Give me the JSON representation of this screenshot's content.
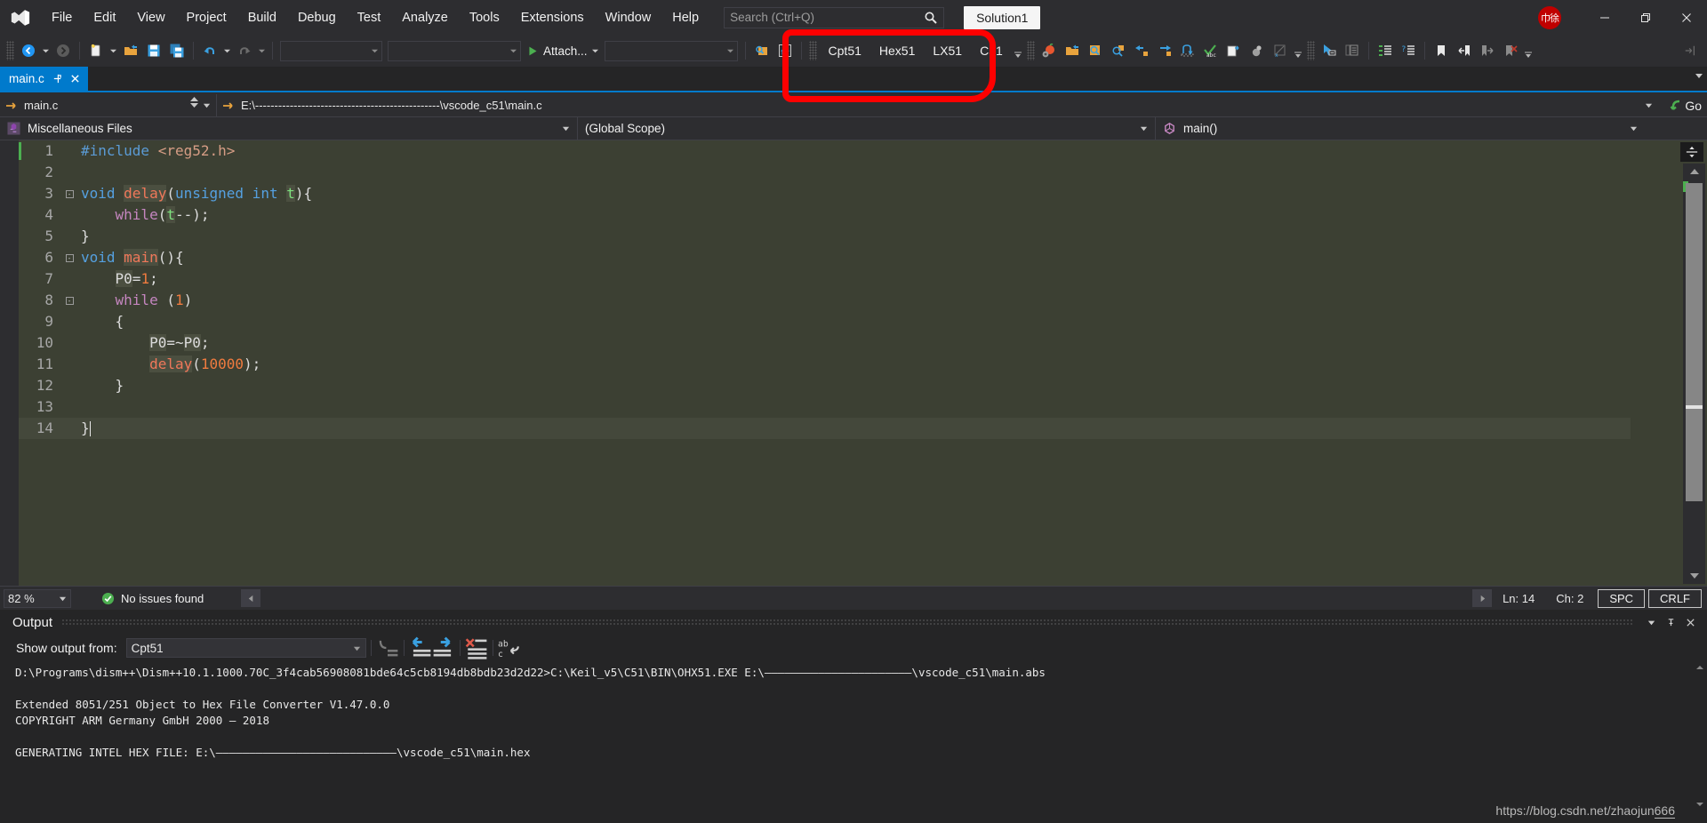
{
  "app": {
    "logo_icon": "visual-studio-logo",
    "solution_chip": "Solution1",
    "avatar_initials": "巾徐"
  },
  "menu": {
    "items": [
      {
        "label": "File"
      },
      {
        "label": "Edit"
      },
      {
        "label": "View"
      },
      {
        "label": "Project"
      },
      {
        "label": "Build"
      },
      {
        "label": "Debug"
      },
      {
        "label": "Test"
      },
      {
        "label": "Analyze"
      },
      {
        "label": "Tools"
      },
      {
        "label": "Extensions"
      },
      {
        "label": "Window"
      },
      {
        "label": "Help"
      }
    ]
  },
  "search": {
    "placeholder": "Search (Ctrl+Q)",
    "value": "",
    "icon": "search-icon"
  },
  "window_controls": {
    "minimize": "minimize-icon",
    "restore": "restore-icon",
    "close": "close-icon"
  },
  "toolbar": {
    "navigate_back_icon": "navigate-back-icon",
    "navigate_forward_icon": "navigate-forward-icon",
    "new_project_icon": "new-project-icon",
    "open_file_icon": "open-file-icon",
    "save_icon": "save-icon",
    "save_all_icon": "save-all-icon",
    "undo_icon": "undo-icon",
    "redo_icon": "redo-icon",
    "combo1_value": "",
    "combo2_value": "",
    "attach_label": "Attach...",
    "combo3_value": "",
    "find_in_files_icon": "find-in-files-icon",
    "home_icon": "home-icon",
    "keil_commands": [
      "Cpt51",
      "Hex51",
      "LX51",
      "C51"
    ],
    "overflow_icon": "toolbar-overflow-icon"
  },
  "annotation": {
    "type": "red-highlight-rectangle",
    "color": "#fe0000",
    "targets": "Cpt51 Hex51 LX51 C51"
  },
  "tabs": [
    {
      "label": "main.c",
      "active": true,
      "pin_icon": "pin-icon",
      "close_icon": "close-icon"
    }
  ],
  "navbar": {
    "file_selector": "main.c",
    "file_path": "E:\\------------------------------------------------\\vscode_c51\\main.c",
    "project": "Miscellaneous Files",
    "scope": "(Global Scope)",
    "member": "main()",
    "go_label": "Go"
  },
  "editor": {
    "background": "#3c4033",
    "cursor_line": 14,
    "lines": [
      {
        "n": 1,
        "fold": "",
        "tokens": [
          {
            "t": "#include ",
            "c": "k-pp"
          },
          {
            "t": "<reg52.h>",
            "c": "k-inc"
          }
        ],
        "mark": true
      },
      {
        "n": 2,
        "fold": "",
        "tokens": []
      },
      {
        "n": 3,
        "fold": "-",
        "tokens": [
          {
            "t": "void ",
            "c": "k-type"
          },
          {
            "t": "delay",
            "c": "k-fn hl"
          },
          {
            "t": "(",
            "c": "k-pl"
          },
          {
            "t": "unsigned int ",
            "c": "k-type"
          },
          {
            "t": "t",
            "c": "k-var hl"
          },
          {
            "t": "){",
            "c": "k-pl"
          }
        ]
      },
      {
        "n": 4,
        "fold": "",
        "tokens": [
          {
            "t": "    ",
            "c": "k-pl"
          },
          {
            "t": "while",
            "c": "k-kw"
          },
          {
            "t": "(",
            "c": "k-pl"
          },
          {
            "t": "t",
            "c": "k-var hl"
          },
          {
            "t": "--);",
            "c": "k-pl"
          }
        ]
      },
      {
        "n": 5,
        "fold": "",
        "tokens": [
          {
            "t": "}",
            "c": "k-pl"
          }
        ]
      },
      {
        "n": 6,
        "fold": "-",
        "tokens": [
          {
            "t": "void ",
            "c": "k-type"
          },
          {
            "t": "main",
            "c": "k-fn hl"
          },
          {
            "t": "(){",
            "c": "k-pl"
          }
        ]
      },
      {
        "n": 7,
        "fold": "",
        "tokens": [
          {
            "t": "    ",
            "c": "k-pl"
          },
          {
            "t": "P0",
            "c": "k-pl hl"
          },
          {
            "t": "=",
            "c": "k-pl"
          },
          {
            "t": "1",
            "c": "k-num"
          },
          {
            "t": ";",
            "c": "k-pl"
          }
        ]
      },
      {
        "n": 8,
        "fold": "-",
        "tokens": [
          {
            "t": "    ",
            "c": "k-pl"
          },
          {
            "t": "while",
            "c": "k-kw"
          },
          {
            "t": " (",
            "c": "k-pl"
          },
          {
            "t": "1",
            "c": "k-num"
          },
          {
            "t": ")",
            "c": "k-pl"
          }
        ]
      },
      {
        "n": 9,
        "fold": "",
        "tokens": [
          {
            "t": "    {",
            "c": "k-pl"
          }
        ]
      },
      {
        "n": 10,
        "fold": "",
        "tokens": [
          {
            "t": "        ",
            "c": "k-pl"
          },
          {
            "t": "P0",
            "c": "k-pl hl"
          },
          {
            "t": "=~",
            "c": "k-pl"
          },
          {
            "t": "P0",
            "c": "k-pl hl"
          },
          {
            "t": ";",
            "c": "k-pl"
          }
        ]
      },
      {
        "n": 11,
        "fold": "",
        "tokens": [
          {
            "t": "        ",
            "c": "k-pl"
          },
          {
            "t": "delay",
            "c": "k-fn hl"
          },
          {
            "t": "(",
            "c": "k-pl"
          },
          {
            "t": "10000",
            "c": "k-num"
          },
          {
            "t": ");",
            "c": "k-pl"
          }
        ]
      },
      {
        "n": 12,
        "fold": "",
        "tokens": [
          {
            "t": "    }",
            "c": "k-pl"
          }
        ]
      },
      {
        "n": 13,
        "fold": "",
        "tokens": []
      },
      {
        "n": 14,
        "fold": "",
        "tokens": [
          {
            "t": "}",
            "c": "k-pl"
          }
        ],
        "cursor": true
      }
    ]
  },
  "editor_status": {
    "zoom": "82 %",
    "issues_icon": "check-circle-icon",
    "issues_text": "No issues found",
    "prev_icon": "nav-prev-icon",
    "next_icon": "nav-next-icon",
    "line": "Ln: 14",
    "col": "Ch: 2",
    "spaces": "SPC",
    "eol": "CRLF"
  },
  "output": {
    "title": "Output",
    "show_from_label": "Show output from:",
    "show_from_value": "Cpt51",
    "toolbar_icons": [
      "go-to-message-icon",
      "find-previous-icon",
      "find-next-icon",
      "clear-all-icon",
      "toggle-word-wrap-icon"
    ],
    "dropdown_icon": "chevron-down-icon",
    "pin_icon": "pin-icon",
    "close_icon": "close-icon",
    "lines": [
      "D:\\Programs\\dism++\\Dism++10.1.1000.70C_3f4cab56908081bde64c5cb8194db8bdb23d2d22>C:\\Keil_v5\\C51\\BIN\\OHX51.EXE E:\\——————————————————————\\vscode_c51\\main.abs",
      "",
      "Extended 8051/251 Object to Hex File Converter V1.47.0.0",
      "COPYRIGHT ARM Germany GmbH 2000 — 2018",
      "",
      "GENERATING INTEL HEX FILE: E:\\———————————————————————————\\vscode_c51\\main.hex"
    ]
  },
  "watermark": {
    "prefix": "https://blog.csdn.net/zhaojun",
    "suffix": "666"
  },
  "colors": {
    "accent": "#007acc",
    "titlebar": "#2d2d30",
    "editor_bg": "#3c4033",
    "panel_bg": "#252526",
    "annotation": "#fe0000"
  }
}
